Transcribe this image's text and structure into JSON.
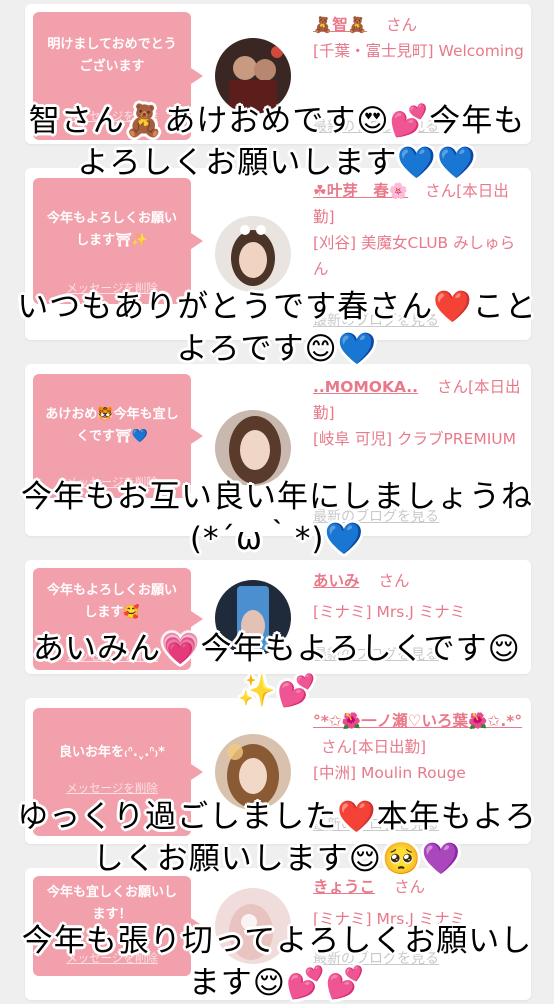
{
  "colors": {
    "background": "#efefef",
    "bubble": "#f2a0ab",
    "accent_pink": "#e8798a",
    "muted_link": "#c9c9c9"
  },
  "common": {
    "delete_label": "メッセージを削除",
    "blog_label": "最新のブログを見る"
  },
  "messages": [
    {
      "message": "明けましておめでとうございます",
      "name": "🧸智🧸",
      "san": "さん",
      "shop": "[千葉・富士見町] Welcoming",
      "caption": "智さん🧸あけおめです😍💕今年もよろしくお願いします💙💙"
    },
    {
      "message": "今年もよろしくお願いします⛩✨",
      "name": "☘叶芽　春🌸",
      "san": "さん[本日出勤]",
      "shop": "[刈谷] 美魔女CLUB みしゅらん",
      "caption": "いつもありがとうです春さん❤️ことよろです😊💙"
    },
    {
      "message": "あけおめ🐯今年も宜しくです⛩💙",
      "name": "..MOMOKA..",
      "san": "さん[本日出勤]",
      "shop": "[岐阜 可児] クラブPREMIUM",
      "caption": "今年もお互い良い年にしましょうね(*´ω｀*)💙"
    },
    {
      "message": "今年もよろしくお願いします🥰",
      "name": "あいみ",
      "san": "さん",
      "shop": "[ミナミ] Mrs.J ミナミ",
      "caption": "あいみん💗今年もよろしくです😌✨💕"
    },
    {
      "message": "良いお年を₍ᐢ.ˬ.ᐢ₎*",
      "name": "°*✩🌺一ノ瀬♡いろ葉🌺✩.*°",
      "san": "さん[本日出勤]",
      "shop": "[中洲] Moulin Rouge",
      "caption": "ゆっくり過ごしました❤️本年もよろしくお願いします😌🥺💜"
    },
    {
      "message": "今年も宜しくお願いします！",
      "name": "きょうこ",
      "san": "さん",
      "shop": "[ミナミ] Mrs.J ミナミ",
      "caption": "今年も張り切ってよろしくお願いします😌💕💕"
    }
  ]
}
